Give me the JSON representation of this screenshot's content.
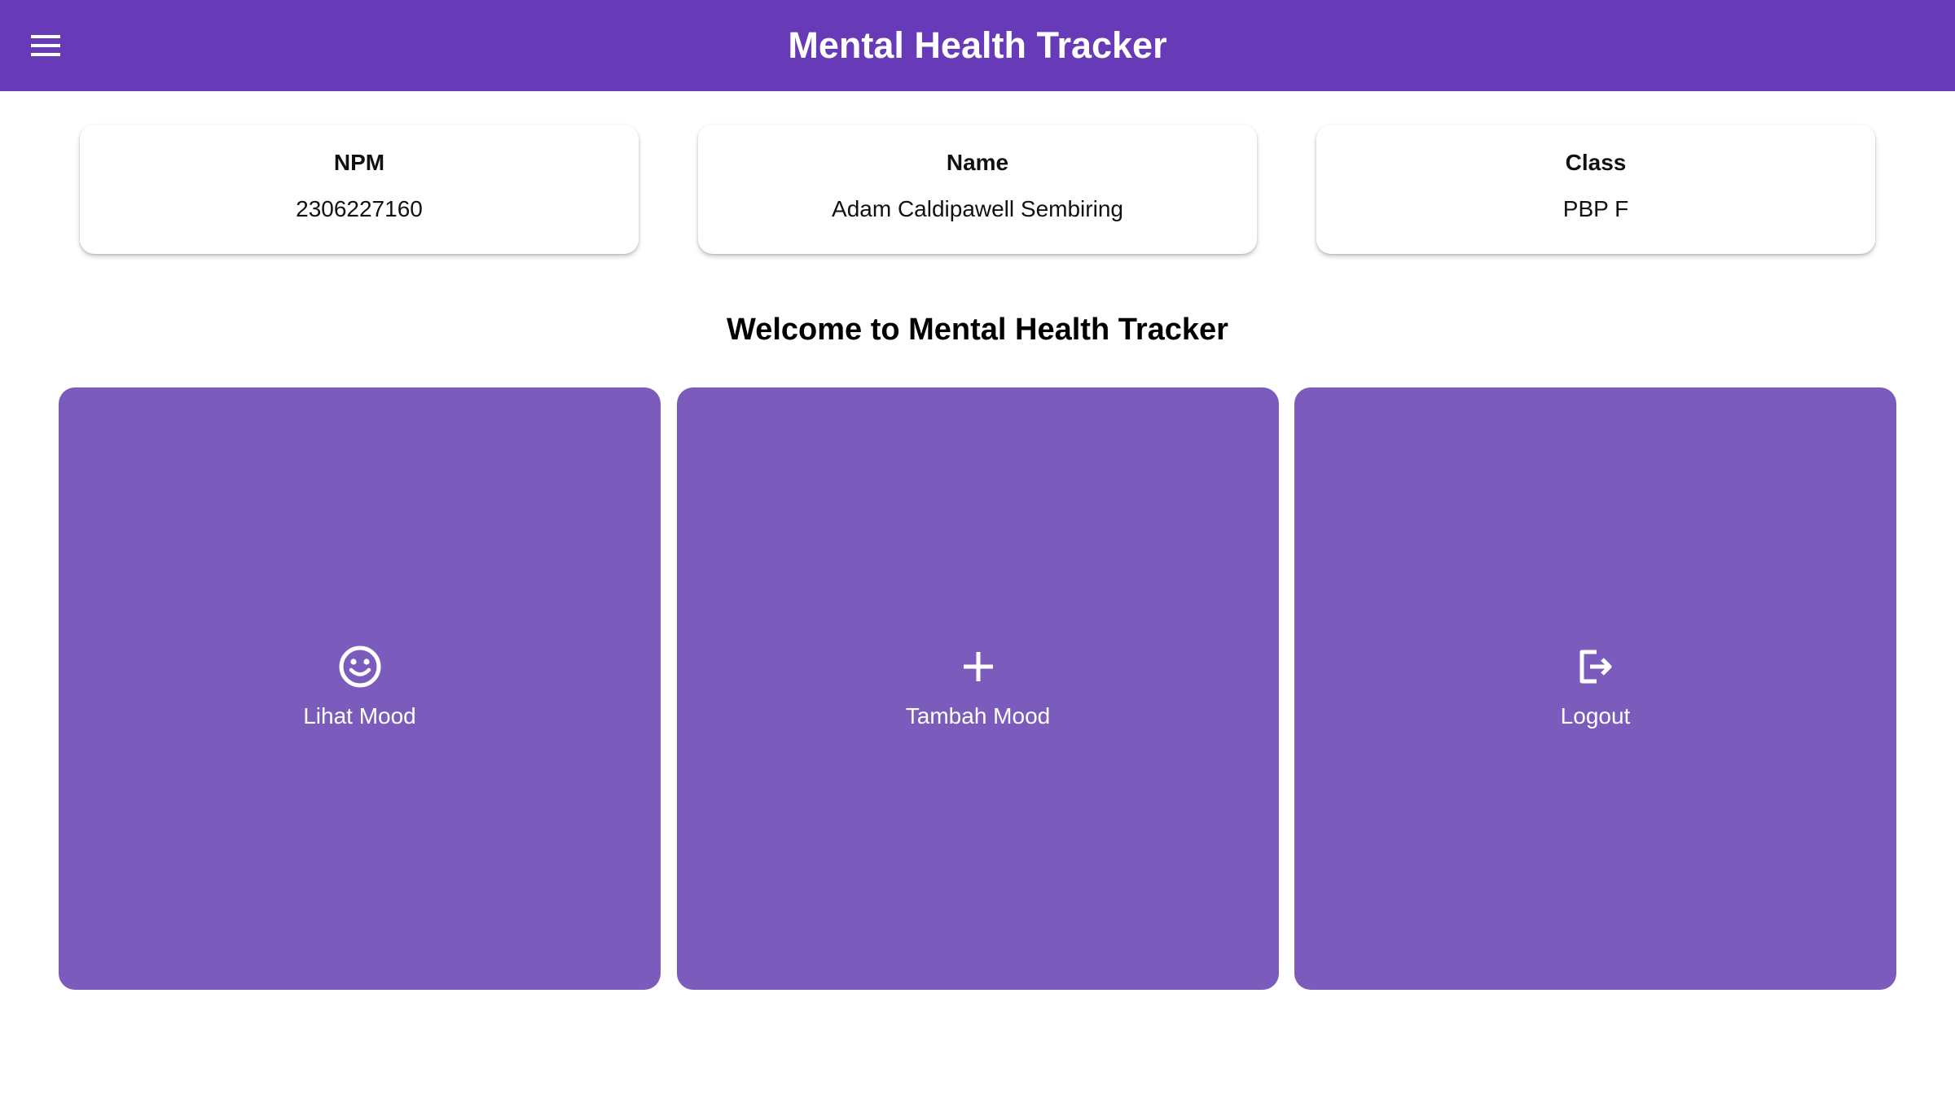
{
  "app_bar": {
    "title": "Mental Health Tracker",
    "menu_icon": "menu-icon",
    "background": "#673ab7"
  },
  "info_cards": [
    {
      "label": "NPM",
      "value": "2306227160"
    },
    {
      "label": "Name",
      "value": "Adam Caldipawell Sembiring"
    },
    {
      "label": "Class",
      "value": "PBP F"
    }
  ],
  "welcome": "Welcome to Mental Health Tracker",
  "tiles": [
    {
      "label": "Lihat Mood",
      "icon": "smiley-icon"
    },
    {
      "label": "Tambah Mood",
      "icon": "plus-icon"
    },
    {
      "label": "Logout",
      "icon": "logout-icon"
    }
  ],
  "colors": {
    "tile_background": "#7b5cbd",
    "text_on_primary": "#ffffff"
  }
}
